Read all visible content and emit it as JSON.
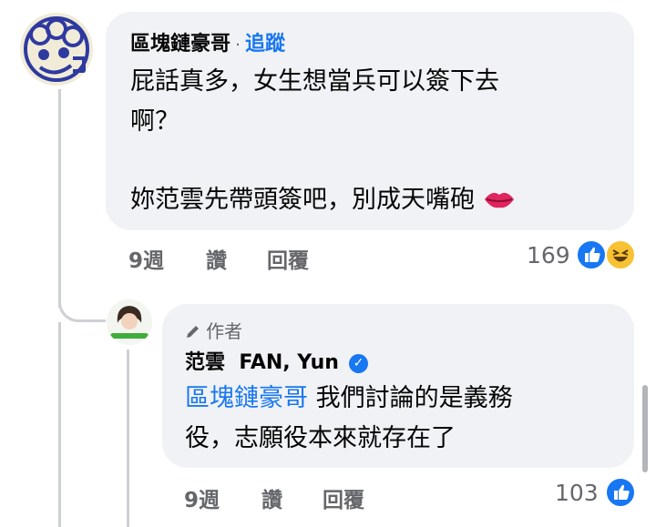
{
  "comment": {
    "author": "區塊鏈豪哥",
    "follow_label": "追蹤",
    "separator": "·",
    "text_line1": "屁話真多，女生想當兵可以簽下去",
    "text_line2": "啊？",
    "text_line3": "妳范雲先帶頭簽吧，別成天嘴砲",
    "emoji": "lips-icon",
    "time": "9週",
    "like_label": "讚",
    "reply_label": "回覆",
    "reaction_count": "169",
    "reactions": [
      "like-icon",
      "haha-icon"
    ]
  },
  "reply": {
    "author_badge": "作者",
    "author": "范雲  FAN, Yun",
    "verified": "verified-badge-icon",
    "mention": "區塊鏈豪哥",
    "text_line1_rest": " 我們討論的是義務",
    "text_line2": "役，志願役本來就存在了",
    "time": "9週",
    "like_label": "讚",
    "reply_label": "回覆",
    "reaction_count": "103",
    "reactions": [
      "like-icon"
    ]
  },
  "colors": {
    "bubble": "#f0f2f5",
    "link_blue": "#1877f2",
    "meta_gray": "#65676b",
    "text": "#050505"
  }
}
